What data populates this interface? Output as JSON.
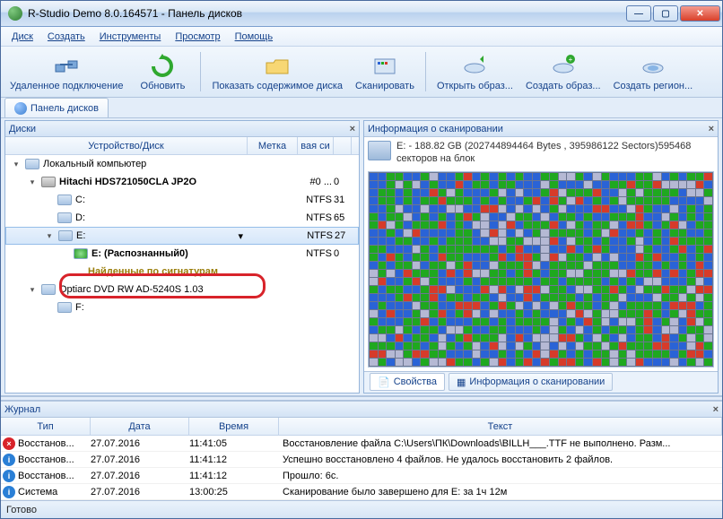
{
  "window": {
    "title": "R-Studio Demo 8.0.164571 - Панель дисков"
  },
  "menu": {
    "items": [
      "Диск",
      "Создать",
      "Инструменты",
      "Просмотр",
      "Помощь"
    ]
  },
  "toolbar": {
    "items": [
      {
        "label": "Удаленное подключение",
        "icon": "network"
      },
      {
        "label": "Обновить",
        "icon": "refresh"
      },
      {
        "label": "Показать содержимое диска",
        "icon": "folder"
      },
      {
        "label": "Сканировать",
        "icon": "scan"
      },
      {
        "label": "Открыть образ...",
        "icon": "open-image"
      },
      {
        "label": "Создать образ...",
        "icon": "create-image"
      },
      {
        "label": "Создать регион...",
        "icon": "create-region"
      }
    ]
  },
  "tabs": {
    "active": "Панель дисков"
  },
  "disks_pane": {
    "title": "Диски",
    "columns": [
      "Устройство/Диск",
      "Метка",
      "вая си",
      ""
    ],
    "rows": [
      {
        "indent": 0,
        "exp": "▾",
        "icon": "pc",
        "name": "Локальный компьютер",
        "fs": "",
        "meta": "",
        "num": ""
      },
      {
        "indent": 1,
        "exp": "▾",
        "icon": "hdd",
        "name": "Hitachi HDS721050CLA JP2O",
        "fs": "#0 ...",
        "meta": "",
        "num": "0",
        "bold": true
      },
      {
        "indent": 2,
        "exp": "",
        "icon": "vol",
        "name": "C:",
        "fs": "NTFS",
        "meta": "",
        "num": "31"
      },
      {
        "indent": 2,
        "exp": "",
        "icon": "vol",
        "name": "D:",
        "fs": "NTFS",
        "meta": "",
        "num": "65"
      },
      {
        "indent": 2,
        "exp": "▾",
        "icon": "vol",
        "name": "E:",
        "fs": "NTFS",
        "meta": "",
        "num": "27",
        "sel": true
      },
      {
        "indent": 3,
        "exp": "",
        "icon": "green",
        "name": "E: (Распознанный0)",
        "fs": "NTFS",
        "meta": "",
        "num": "0",
        "bold": true
      },
      {
        "indent": 3,
        "exp": "",
        "icon": "none",
        "name": "Найденные по сигнатурам",
        "fs": "",
        "meta": "",
        "num": "",
        "highlight": true
      },
      {
        "indent": 1,
        "exp": "▾",
        "icon": "cd",
        "name": "Optiarc DVD RW AD-5240S 1.03",
        "fs": "",
        "meta": "",
        "num": ""
      },
      {
        "indent": 2,
        "exp": "",
        "icon": "vol",
        "name": "F:",
        "fs": "",
        "meta": "",
        "num": ""
      }
    ]
  },
  "scan_pane": {
    "title": "Информация о сканировании",
    "summary_line1": "E: - 188.82 GB (202744894464 Bytes , 395986122 Sectors)595468",
    "summary_line2": "секторов на блок",
    "tabs": [
      "Свойства",
      "Информация о сканировании"
    ]
  },
  "journal": {
    "title": "Журнал",
    "columns": [
      "Тип",
      "Дата",
      "Время",
      "Текст"
    ],
    "rows": [
      {
        "icon": "err",
        "type": "Восстанов...",
        "date": "27.07.2016",
        "time": "11:41:05",
        "text": "Восстановление файла C:\\Users\\ПК\\Downloads\\BILLH___.TTF не выполнено. Разм..."
      },
      {
        "icon": "info",
        "type": "Восстанов...",
        "date": "27.07.2016",
        "time": "11:41:12",
        "text": "Успешно восстановлено 4 файлов. Не удалось восстановить 2 файлов."
      },
      {
        "icon": "info",
        "type": "Восстанов...",
        "date": "27.07.2016",
        "time": "11:41:12",
        "text": "Прошло: 6с."
      },
      {
        "icon": "info",
        "type": "Система",
        "date": "27.07.2016",
        "time": "13:00:25",
        "text": "Сканирование было завершено для E: за 1ч 12м"
      }
    ]
  },
  "status": {
    "text": "Готово"
  }
}
